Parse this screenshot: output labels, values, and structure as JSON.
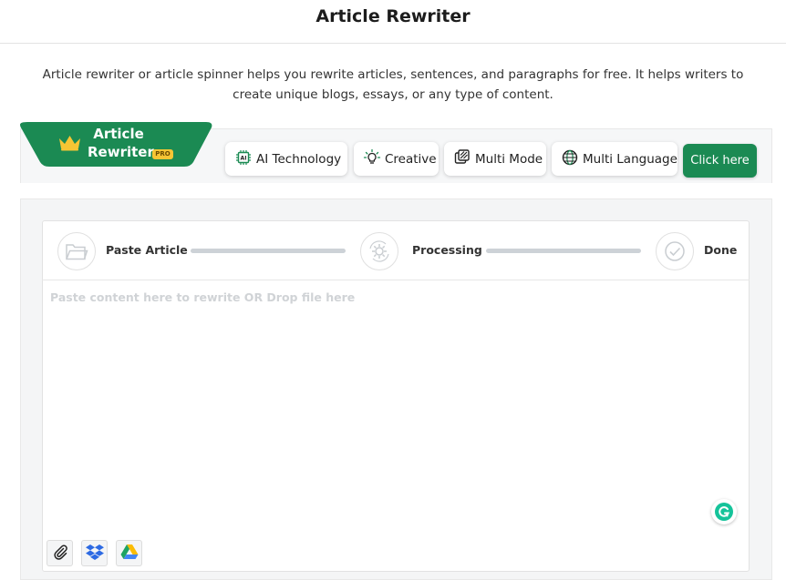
{
  "header": {
    "title": "Article Rewriter"
  },
  "intro": {
    "text": "Article rewriter or article spinner helps you rewrite articles, sentences, and paragraphs for free. It helps writers to create unique blogs, essays, or any type of content."
  },
  "brand": {
    "line1": "Article",
    "line2": "Rewriter",
    "badge": "PRO",
    "icon": "crown-icon"
  },
  "features": [
    {
      "label": "AI Technology",
      "icon": "ai-chip-icon"
    },
    {
      "label": "Creative",
      "icon": "lightbulb-icon"
    },
    {
      "label": "Multi Mode",
      "icon": "multi-mode-icon"
    },
    {
      "label": "Multi Language",
      "icon": "globe-icon"
    }
  ],
  "cta": {
    "label": "Click here"
  },
  "steps": [
    {
      "label": "Paste Article",
      "icon": "folder-icon"
    },
    {
      "label": "Processing",
      "icon": "gear-icon"
    },
    {
      "label": "Done",
      "icon": "check-circle-icon"
    }
  ],
  "editor": {
    "placeholder": "Paste content here to rewrite OR Drop file here"
  },
  "tools": [
    {
      "name": "attach",
      "icon": "paperclip-icon"
    },
    {
      "name": "dropbox",
      "icon": "dropbox-icon"
    },
    {
      "name": "google-drive",
      "icon": "google-drive-icon"
    }
  ],
  "colors": {
    "brand_green": "#1b8a53",
    "badge_yellow": "#f6c534",
    "track_gray": "#cdd2d7"
  }
}
